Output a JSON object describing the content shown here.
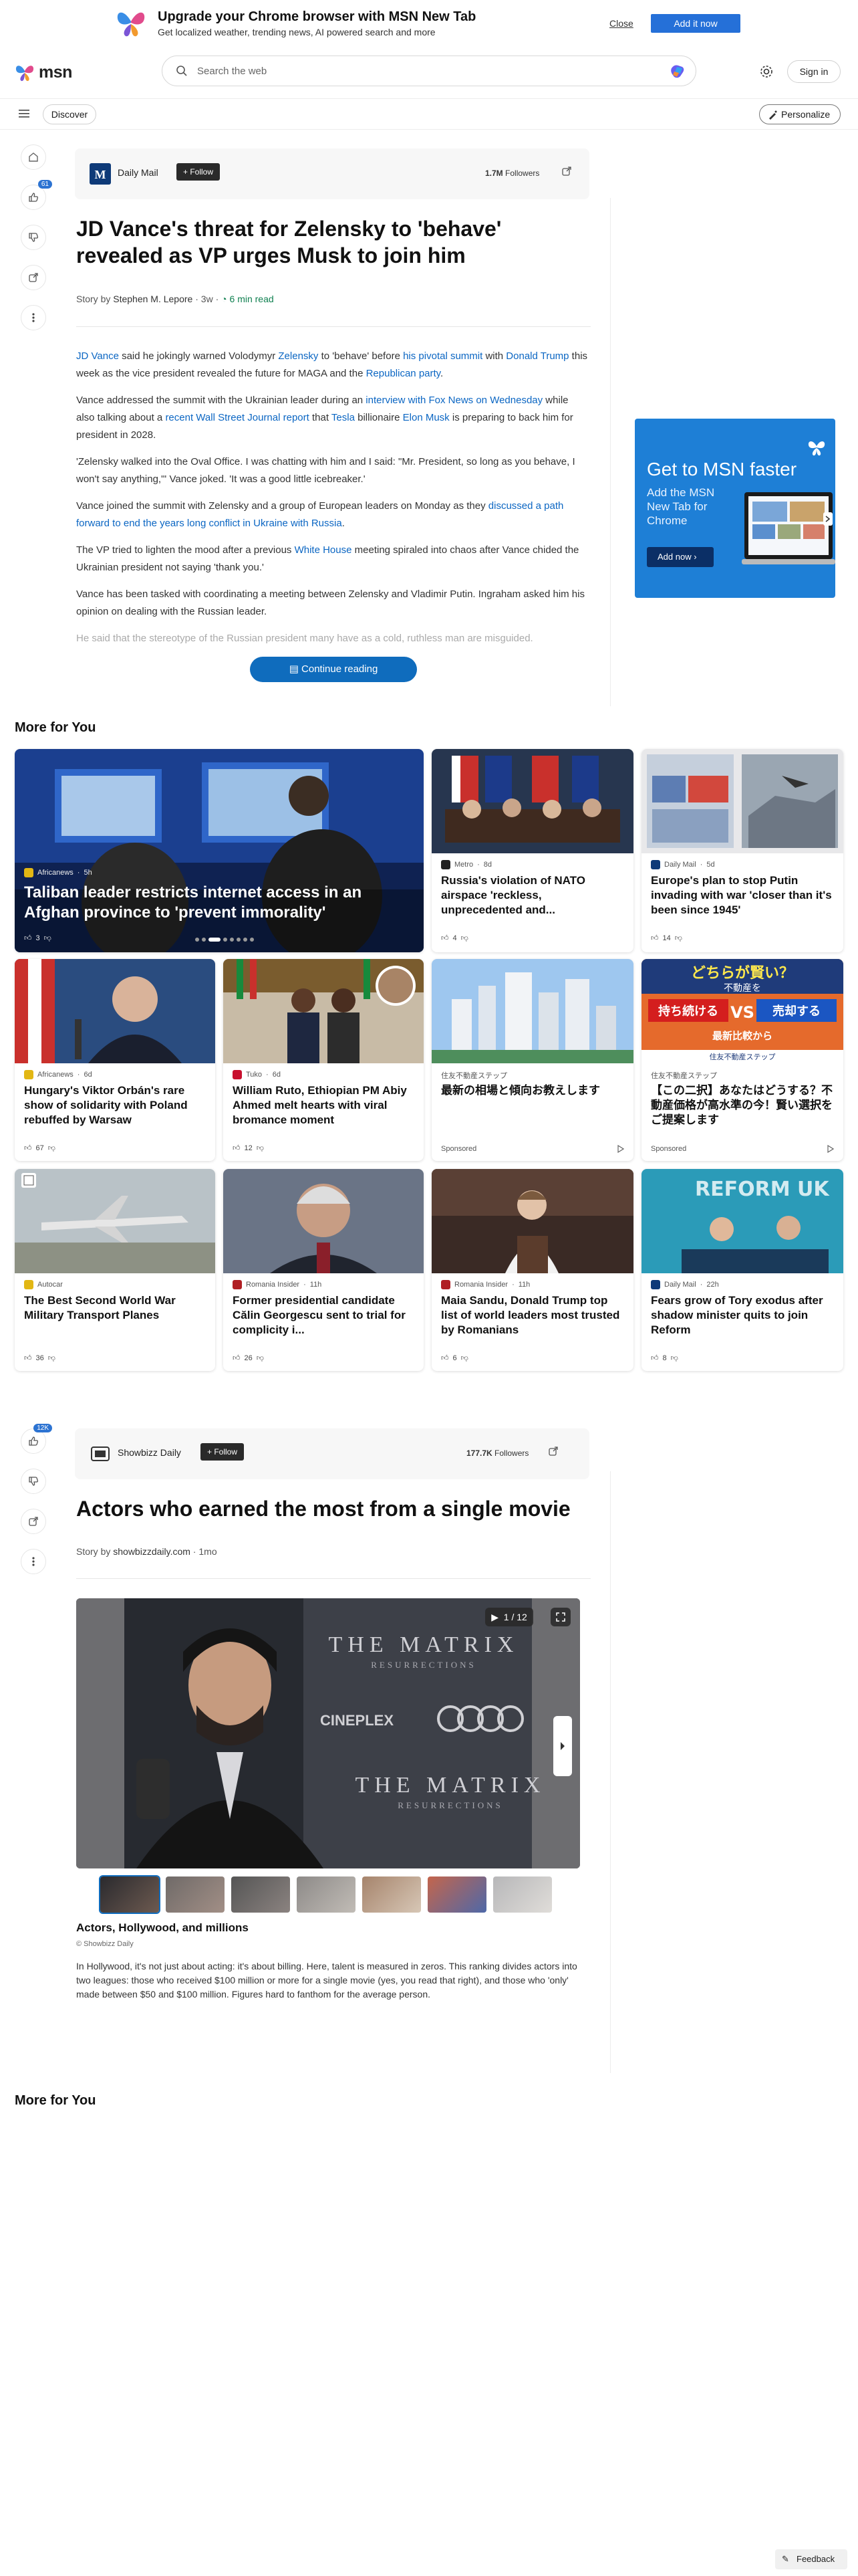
{
  "promo": {
    "title": "Upgrade your Chrome browser with MSN New Tab",
    "subtitle": "Get localized weather, trending news, AI powered search and more",
    "close_label": "Close",
    "add_label": "Add it now"
  },
  "header": {
    "logo_text": "msn",
    "search_placeholder": "Search the web",
    "signin_label": "Sign in"
  },
  "subnav": {
    "discover_label": "Discover",
    "personalize_label": "Personalize"
  },
  "rail1": {
    "like_count": "61"
  },
  "rail2": {
    "like_count": "12K"
  },
  "article": {
    "publisher": "Daily Mail",
    "follow_label": "Follow",
    "followers": "1.7M",
    "followers_label": "Followers",
    "title": "JD Vance's threat for Zelensky to 'behave' revealed as VP urges Musk to join him",
    "byline_prefix": "Story by",
    "author": "Stephen M. Lepore",
    "age": "3w",
    "read_time": "6 min read",
    "paragraphs": [
      [
        {
          "t": "JD Vance",
          "link": true
        },
        {
          "t": " said he jokingly warned Volodymyr "
        },
        {
          "t": "Zelensky",
          "link": true
        },
        {
          "t": " to 'behave' before "
        },
        {
          "t": "his pivotal summit",
          "link": true
        },
        {
          "t": " with "
        },
        {
          "t": "Donald Trump",
          "link": true
        },
        {
          "t": " this week as the vice president revealed the future for MAGA and the "
        },
        {
          "t": "Republican party",
          "link": true
        },
        {
          "t": "."
        }
      ],
      [
        {
          "t": "Vance addressed the summit with the Ukrainian leader during an "
        },
        {
          "t": "interview with Fox News on Wednesday",
          "link": true
        },
        {
          "t": " while also talking about a "
        },
        {
          "t": "recent Wall Street Journal report",
          "link": true
        },
        {
          "t": " that "
        },
        {
          "t": "Tesla",
          "link": true
        },
        {
          "t": " billionaire "
        },
        {
          "t": "Elon Musk",
          "link": true
        },
        {
          "t": " is preparing to back him for president in 2028."
        }
      ],
      [
        {
          "t": "'Zelensky walked into the Oval Office. I was chatting with him and I said: \"Mr. President, so long as you behave, I won't say anything,\"' Vance joked. 'It was a good little icebreaker.'"
        }
      ],
      [
        {
          "t": "Vance joined the summit with Zelensky and a group of European leaders on Monday as they "
        },
        {
          "t": "discussed a path forward to end the years long conflict in Ukraine with Russia",
          "link": true
        },
        {
          "t": "."
        }
      ],
      [
        {
          "t": "The VP tried to lighten the mood after a previous "
        },
        {
          "t": "White House",
          "link": true
        },
        {
          "t": " meeting spiraled into chaos after Vance chided the Ukrainian president not saying 'thank you.'"
        }
      ],
      [
        {
          "t": "Vance has been tasked with coordinating a meeting between Zelensky and Vladimir Putin. Ingraham asked him his opinion on dealing with the Russian leader."
        }
      ],
      [
        {
          "t": "He said that the stereotype of the Russian president many have as a cold, ruthless man are misguided."
        }
      ]
    ],
    "continue_label": "Continue reading"
  },
  "ad": {
    "headline": "Get to MSN faster",
    "body": "Add the MSN New Tab for Chrome",
    "button": "Add now"
  },
  "feed1": {
    "heading": "More for You",
    "cards": [
      {
        "source": "Africanews",
        "age": "5h",
        "title": "Taliban leader restricts internet access in an Afghan province to 'prevent immorality'",
        "likes": "3",
        "color": "#e2b714"
      },
      {
        "source": "Metro",
        "age": "8d",
        "title": "Russia's violation of NATO airspace 'reckless, unprecedented and...",
        "likes": "4",
        "color": "#222222"
      },
      {
        "source": "Daily Mail",
        "age": "5d",
        "title": "Europe's plan to stop Putin invading with war 'closer than it's been since 1945'",
        "likes": "14",
        "color": "#0e3a78"
      },
      {
        "source": "Africanews",
        "age": "6d",
        "title": "Hungary's Viktor Orbán's rare show of solidarity with Poland rebuffed by Warsaw",
        "likes": "67",
        "color": "#e2b714"
      },
      {
        "source": "Tuko",
        "age": "6d",
        "title": "William Ruto, Ethiopian PM Abiy Ahmed melt hearts with viral bromance moment",
        "likes": "12",
        "color": "#c8102e"
      },
      {
        "source": "住友不動産ステップ",
        "title": "最新の相場と傾向お教えします",
        "sponsored": "Sponsored"
      },
      {
        "source": "住友不動産ステップ",
        "title": "【この二択】あなたはどうする？不動産価格が高水準の今！賢い選択をご提案します",
        "sponsored": "Sponsored",
        "img_text1": "どちらが賢い？",
        "img_text2": "不動産を",
        "img_text3": "持ち続ける",
        "img_vs": "VS",
        "img_text4": "売却する",
        "img_text5": "最新比較から",
        "img_footer": "住友不動産ステップ"
      },
      {
        "source": "Autocar",
        "title": "The Best Second World War Military Transport Planes",
        "likes": "36",
        "color": "#e2b714"
      },
      {
        "source": "Romania Insider",
        "age": "11h",
        "title": "Former presidential candidate Călin Georgescu sent to trial for complicity i...",
        "likes": "26",
        "color": "#b01f24"
      },
      {
        "source": "Romania Insider",
        "age": "11h",
        "title": "Maia Sandu, Donald Trump top list of world leaders most trusted by Romanians",
        "likes": "6",
        "color": "#b01f24"
      },
      {
        "source": "Daily Mail",
        "age": "22h",
        "title": "Fears grow of Tory exodus after shadow minister quits to join Reform",
        "likes": "8",
        "color": "#0e3a78",
        "img_text": "REFORM UK"
      }
    ]
  },
  "article2": {
    "publisher": "Showbizz Daily",
    "follow_label": "Follow",
    "followers": "177.7K",
    "followers_label": "Followers",
    "title": "Actors who earned the most from a single movie",
    "byline_prefix": "Story by",
    "author": "showbizzdaily.com",
    "age": "1mo",
    "gallery_counter": "1 / 12",
    "gallery_backdrop_1": "THE MATRIX",
    "gallery_backdrop_1b": "RESURRECTIONS",
    "gallery_backdrop_2": "CINEPLEX",
    "gallery_backdrop_3": "THE MATRIX",
    "gallery_backdrop_3b": "RESURRECTIONS",
    "gallery_title": "Actors, Hollywood, and millions",
    "gallery_source": "© Showbizz Daily",
    "gallery_text": "In Hollywood, it's not just about acting: it's about billing. Here, talent is measured in zeros. This ranking divides actors into two leagues: those who received $100 million or more for a single movie (yes, you read that right), and those who 'only' made between $50 and $100 million. Figures hard to fanthom for the average person."
  },
  "feed2": {
    "heading": "More for You"
  },
  "feedback_label": "Feedback"
}
